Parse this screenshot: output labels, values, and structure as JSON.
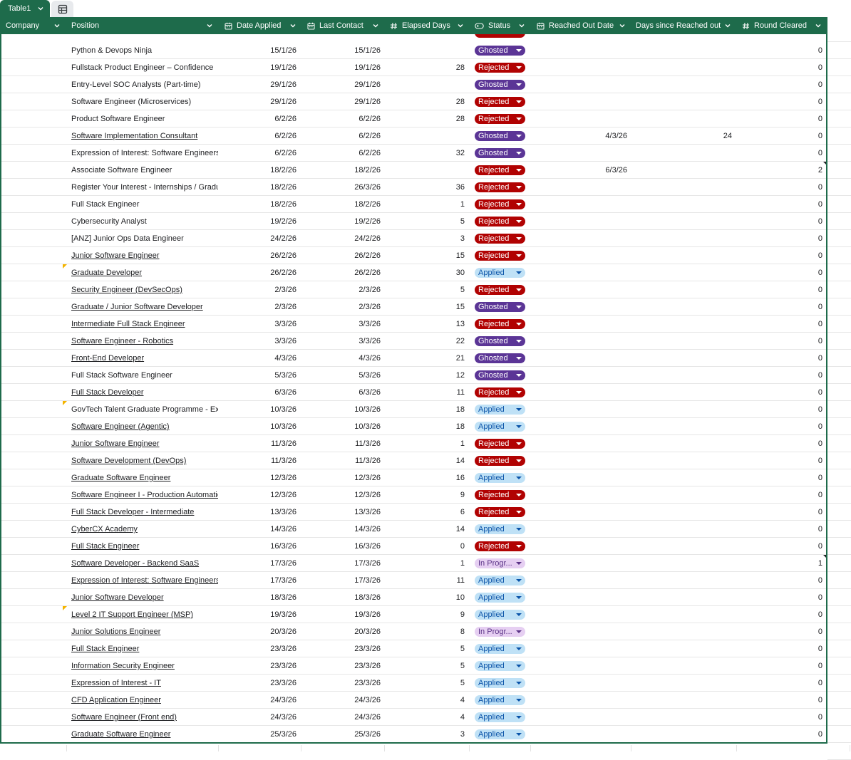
{
  "sheet": {
    "table_tab_label": "Table1",
    "table_icon": "table-grid-icon"
  },
  "columns": [
    {
      "key": "company",
      "label": "Company",
      "icon": ""
    },
    {
      "key": "position",
      "label": "Position",
      "icon": ""
    },
    {
      "key": "date_applied",
      "label": "Date Applied",
      "icon": "calendar-icon"
    },
    {
      "key": "last_contact",
      "label": "Last Contact",
      "icon": "calendar-icon"
    },
    {
      "key": "elapsed_days",
      "label": "Elapsed Days",
      "icon": "hash-icon"
    },
    {
      "key": "status",
      "label": "Status",
      "icon": "dropdown-chip-icon"
    },
    {
      "key": "reached_out_date",
      "label": "Reached Out Date",
      "icon": "calendar-icon"
    },
    {
      "key": "days_since_reached_out",
      "label": "Days since Reached out",
      "icon": ""
    },
    {
      "key": "round_cleared",
      "label": "Round Cleared",
      "icon": "hash-icon"
    }
  ],
  "status_colors": {
    "Ghosted": "#5b3596",
    "Rejected": "#b10202",
    "Applied": "#bfe1f6",
    "In Progr...": "#e6cff2"
  },
  "rows": [
    {
      "position": "Python & Devops Ninja",
      "link": false,
      "date_applied": "15/1/26",
      "last_contact": "15/1/26",
      "elapsed": "",
      "status": "Ghosted",
      "reached": "",
      "days_since": "",
      "round": "0",
      "note": false,
      "corner": false
    },
    {
      "position": "Fullstack Product Engineer – Confidence",
      "link": false,
      "date_applied": "19/1/26",
      "last_contact": "19/1/26",
      "elapsed": "28",
      "status": "Rejected",
      "reached": "",
      "days_since": "",
      "round": "0",
      "note": false,
      "corner": false
    },
    {
      "position": "Entry-Level SOC Analysts (Part-time)",
      "link": false,
      "date_applied": "29/1/26",
      "last_contact": "29/1/26",
      "elapsed": "",
      "status": "Ghosted",
      "reached": "",
      "days_since": "",
      "round": "0",
      "note": false,
      "corner": false
    },
    {
      "position": "Software Engineer (Microservices)",
      "link": false,
      "date_applied": "29/1/26",
      "last_contact": "29/1/26",
      "elapsed": "28",
      "status": "Rejected",
      "reached": "",
      "days_since": "",
      "round": "0",
      "note": false,
      "corner": false
    },
    {
      "position": "Product Software Engineer",
      "link": false,
      "date_applied": "6/2/26",
      "last_contact": "6/2/26",
      "elapsed": "28",
      "status": "Rejected",
      "reached": "",
      "days_since": "",
      "round": "0",
      "note": false,
      "corner": false
    },
    {
      "position": "Software Implementation Consultant",
      "link": true,
      "date_applied": "6/2/26",
      "last_contact": "6/2/26",
      "elapsed": "",
      "status": "Ghosted",
      "reached": "4/3/26",
      "days_since": "24",
      "round": "0",
      "note": false,
      "corner": false
    },
    {
      "position": "Expression of Interest: Software Engineers (",
      "link": false,
      "date_applied": "6/2/26",
      "last_contact": "6/2/26",
      "elapsed": "32",
      "status": "Ghosted",
      "reached": "",
      "days_since": "",
      "round": "0",
      "note": false,
      "corner": false
    },
    {
      "position": "Associate Software Engineer",
      "link": false,
      "date_applied": "18/2/26",
      "last_contact": "18/2/26",
      "elapsed": "",
      "status": "Rejected",
      "reached": "6/3/26",
      "days_since": "",
      "round": "2",
      "note": false,
      "corner": true
    },
    {
      "position": "Register Your Interest - Internships / Gradua",
      "link": false,
      "date_applied": "18/2/26",
      "last_contact": "26/3/26",
      "elapsed": "36",
      "status": "Rejected",
      "reached": "",
      "days_since": "",
      "round": "0",
      "note": false,
      "corner": false
    },
    {
      "position": "Full Stack Engineer",
      "link": false,
      "date_applied": "18/2/26",
      "last_contact": "18/2/26",
      "elapsed": "1",
      "status": "Rejected",
      "reached": "",
      "days_since": "",
      "round": "0",
      "note": false,
      "corner": false
    },
    {
      "position": "Cybersecurity Analyst",
      "link": false,
      "date_applied": "19/2/26",
      "last_contact": "19/2/26",
      "elapsed": "5",
      "status": "Rejected",
      "reached": "",
      "days_since": "",
      "round": "0",
      "note": false,
      "corner": false
    },
    {
      "position": "[ANZ] Junior Ops Data Engineer",
      "link": false,
      "date_applied": "24/2/26",
      "last_contact": "24/2/26",
      "elapsed": "3",
      "status": "Rejected",
      "reached": "",
      "days_since": "",
      "round": "0",
      "note": false,
      "corner": false
    },
    {
      "position": "Junior Software Engineer",
      "link": true,
      "date_applied": "26/2/26",
      "last_contact": "26/2/26",
      "elapsed": "15",
      "status": "Rejected",
      "reached": "",
      "days_since": "",
      "round": "0",
      "note": false,
      "corner": false
    },
    {
      "position": "Graduate Developer",
      "link": true,
      "date_applied": "26/2/26",
      "last_contact": "26/2/26",
      "elapsed": "30",
      "status": "Applied",
      "reached": "",
      "days_since": "",
      "round": "0",
      "note": true,
      "corner": false
    },
    {
      "position": "Security Engineer (DevSecOps)",
      "link": true,
      "date_applied": "2/3/26",
      "last_contact": "2/3/26",
      "elapsed": "5",
      "status": "Rejected",
      "reached": "",
      "days_since": "",
      "round": "0",
      "note": false,
      "corner": false
    },
    {
      "position": "Graduate / Junior Software Developer",
      "link": true,
      "date_applied": "2/3/26",
      "last_contact": "2/3/26",
      "elapsed": "15",
      "status": "Ghosted",
      "reached": "",
      "days_since": "",
      "round": "0",
      "note": false,
      "corner": false
    },
    {
      "position": "Intermediate Full Stack Engineer",
      "link": true,
      "date_applied": "3/3/26",
      "last_contact": "3/3/26",
      "elapsed": "13",
      "status": "Rejected",
      "reached": "",
      "days_since": "",
      "round": "0",
      "note": false,
      "corner": false
    },
    {
      "position": "Software Engineer - Robotics",
      "link": true,
      "date_applied": "3/3/26",
      "last_contact": "3/3/26",
      "elapsed": "22",
      "status": "Ghosted",
      "reached": "",
      "days_since": "",
      "round": "0",
      "note": false,
      "corner": false
    },
    {
      "position": "Front-End Developer",
      "link": true,
      "date_applied": "4/3/26",
      "last_contact": "4/3/26",
      "elapsed": "21",
      "status": "Ghosted",
      "reached": "",
      "days_since": "",
      "round": "0",
      "note": false,
      "corner": false
    },
    {
      "position": "Full Stack Software Engineer",
      "link": false,
      "date_applied": "5/3/26",
      "last_contact": "5/3/26",
      "elapsed": "12",
      "status": "Ghosted",
      "reached": "",
      "days_since": "",
      "round": "0",
      "note": false,
      "corner": false
    },
    {
      "position": "Full Stack Developer",
      "link": true,
      "date_applied": "6/3/26",
      "last_contact": "6/3/26",
      "elapsed": "11",
      "status": "Rejected",
      "reached": "",
      "days_since": "",
      "round": "0",
      "note": false,
      "corner": false
    },
    {
      "position": "GovTech Talent Graduate Programme - Expr",
      "link": false,
      "date_applied": "10/3/26",
      "last_contact": "10/3/26",
      "elapsed": "18",
      "status": "Applied",
      "reached": "",
      "days_since": "",
      "round": "0",
      "note": true,
      "corner": false
    },
    {
      "position": "Software Engineer (Agentic)",
      "link": true,
      "date_applied": "10/3/26",
      "last_contact": "10/3/26",
      "elapsed": "18",
      "status": "Applied",
      "reached": "",
      "days_since": "",
      "round": "0",
      "note": false,
      "corner": false
    },
    {
      "position": "Junior Software Engineer",
      "link": true,
      "date_applied": "11/3/26",
      "last_contact": "11/3/26",
      "elapsed": "1",
      "status": "Rejected",
      "reached": "",
      "days_since": "",
      "round": "0",
      "note": false,
      "corner": false
    },
    {
      "position": "Software Development (DevOps)",
      "link": true,
      "date_applied": "11/3/26",
      "last_contact": "11/3/26",
      "elapsed": "14",
      "status": "Rejected",
      "reached": "",
      "days_since": "",
      "round": "0",
      "note": false,
      "corner": false
    },
    {
      "position": "Graduate Software Engineer",
      "link": true,
      "date_applied": "12/3/26",
      "last_contact": "12/3/26",
      "elapsed": "16",
      "status": "Applied",
      "reached": "",
      "days_since": "",
      "round": "0",
      "note": false,
      "corner": false
    },
    {
      "position": "Software Engineer I - Production Automatio",
      "link": true,
      "date_applied": "12/3/26",
      "last_contact": "12/3/26",
      "elapsed": "9",
      "status": "Rejected",
      "reached": "",
      "days_since": "",
      "round": "0",
      "note": false,
      "corner": false
    },
    {
      "position": "Full Stack Developer - Intermediate",
      "link": true,
      "date_applied": "13/3/26",
      "last_contact": "13/3/26",
      "elapsed": "6",
      "status": "Rejected",
      "reached": "",
      "days_since": "",
      "round": "0",
      "note": false,
      "corner": false
    },
    {
      "position": "CyberCX Academy",
      "link": true,
      "date_applied": "14/3/26",
      "last_contact": "14/3/26",
      "elapsed": "14",
      "status": "Applied",
      "reached": "",
      "days_since": "",
      "round": "0",
      "note": false,
      "corner": false
    },
    {
      "position": "Full Stack Engineer",
      "link": true,
      "date_applied": "16/3/26",
      "last_contact": "16/3/26",
      "elapsed": "0",
      "status": "Rejected",
      "reached": "",
      "days_since": "",
      "round": "0",
      "note": false,
      "corner": false
    },
    {
      "position": "Software Developer - Backend SaaS",
      "link": true,
      "date_applied": "17/3/26",
      "last_contact": "17/3/26",
      "elapsed": "1",
      "status": "In Progr...",
      "reached": "",
      "days_since": "",
      "round": "1",
      "note": false,
      "corner": true
    },
    {
      "position": "Expression of Interest: Software Engineers (",
      "link": true,
      "date_applied": "17/3/26",
      "last_contact": "17/3/26",
      "elapsed": "11",
      "status": "Applied",
      "reached": "",
      "days_since": "",
      "round": "0",
      "note": false,
      "corner": false
    },
    {
      "position": "Junior Software Developer",
      "link": true,
      "date_applied": "18/3/26",
      "last_contact": "18/3/26",
      "elapsed": "10",
      "status": "Applied",
      "reached": "",
      "days_since": "",
      "round": "0",
      "note": false,
      "corner": false
    },
    {
      "position": "Level 2 IT Support Engineer (MSP)",
      "link": true,
      "date_applied": "19/3/26",
      "last_contact": "19/3/26",
      "elapsed": "9",
      "status": "Applied",
      "reached": "",
      "days_since": "",
      "round": "0",
      "note": true,
      "corner": false
    },
    {
      "position": "Junior Solutions Engineer",
      "link": true,
      "date_applied": "20/3/26",
      "last_contact": "20/3/26",
      "elapsed": "8",
      "status": "In Progr...",
      "reached": "",
      "days_since": "",
      "round": "0",
      "note": false,
      "corner": false
    },
    {
      "position": "Full Stack Engineer",
      "link": true,
      "date_applied": "23/3/26",
      "last_contact": "23/3/26",
      "elapsed": "5",
      "status": "Applied",
      "reached": "",
      "days_since": "",
      "round": "0",
      "note": false,
      "corner": false
    },
    {
      "position": "Information Security Engineer",
      "link": true,
      "date_applied": "23/3/26",
      "last_contact": "23/3/26",
      "elapsed": "5",
      "status": "Applied",
      "reached": "",
      "days_since": "",
      "round": "0",
      "note": false,
      "corner": false
    },
    {
      "position": "Expression of Interest - IT",
      "link": true,
      "date_applied": "23/3/26",
      "last_contact": "23/3/26",
      "elapsed": "5",
      "status": "Applied",
      "reached": "",
      "days_since": "",
      "round": "0",
      "note": false,
      "corner": false
    },
    {
      "position": "CFD Application Engineer",
      "link": true,
      "date_applied": "24/3/26",
      "last_contact": "24/3/26",
      "elapsed": "4",
      "status": "Applied",
      "reached": "",
      "days_since": "",
      "round": "0",
      "note": false,
      "corner": false
    },
    {
      "position": "Software Engineer (Front end)",
      "link": true,
      "date_applied": "24/3/26",
      "last_contact": "24/3/26",
      "elapsed": "4",
      "status": "Applied",
      "reached": "",
      "days_since": "",
      "round": "0",
      "note": false,
      "corner": false
    },
    {
      "position": "Graduate Software Engineer",
      "link": true,
      "date_applied": "25/3/26",
      "last_contact": "25/3/26",
      "elapsed": "3",
      "status": "Applied",
      "reached": "",
      "days_since": "",
      "round": "0",
      "note": false,
      "corner": false
    }
  ]
}
